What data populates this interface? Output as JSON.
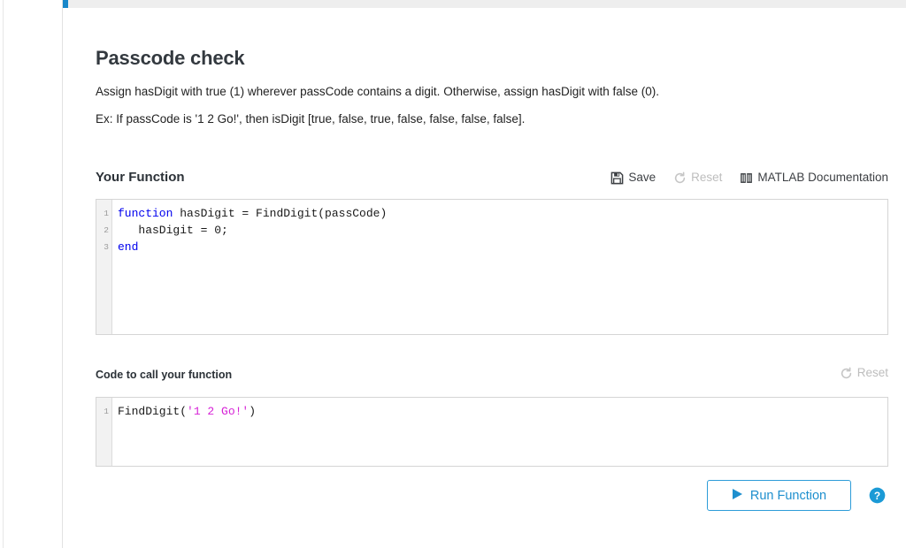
{
  "topbar": {
    "marker_color": "#1887c9",
    "track_color": "#eeeeee"
  },
  "problem": {
    "title": "Passcode check",
    "description": "Assign hasDigit with true (1) wherever passCode contains a digit. Otherwise, assign hasDigit with false (0).",
    "example": "Ex: If passCode is '1 2 Go!', then isDigit [true, false, true, false, false, false, false]."
  },
  "your_function": {
    "heading": "Your Function",
    "toolbar": {
      "save_label": "Save",
      "save_icon": "save-floppy-icon",
      "reset_label": "Reset",
      "reset_icon": "refresh-circular-arrow-icon",
      "reset_disabled": true,
      "docs_label": "MATLAB Documentation",
      "docs_icon": "open-book-icon"
    },
    "editor": {
      "line_numbers": [
        "1",
        "2",
        "3"
      ],
      "lines": [
        [
          {
            "t": "function",
            "c": "kw"
          },
          {
            "t": " hasDigit = FindDigit(passCode)",
            "c": ""
          }
        ],
        [
          {
            "t": "   hasDigit = 0;",
            "c": ""
          }
        ],
        [
          {
            "t": "end",
            "c": "kw"
          }
        ]
      ]
    }
  },
  "call_code": {
    "heading": "Code to call your function",
    "toolbar": {
      "reset_label": "Reset",
      "reset_icon": "refresh-circular-arrow-icon",
      "reset_disabled": true
    },
    "editor": {
      "line_numbers": [
        "1"
      ],
      "lines": [
        [
          {
            "t": "FindDigit(",
            "c": ""
          },
          {
            "t": "'1 2 Go!'",
            "c": "str"
          },
          {
            "t": ")",
            "c": ""
          }
        ]
      ]
    }
  },
  "actions": {
    "run_label": "Run Function",
    "run_icon": "play-triangle-icon",
    "run_accent": "#1e8fce",
    "help_icon": "question-mark-circle-icon",
    "help_color": "#1b9ad6"
  }
}
